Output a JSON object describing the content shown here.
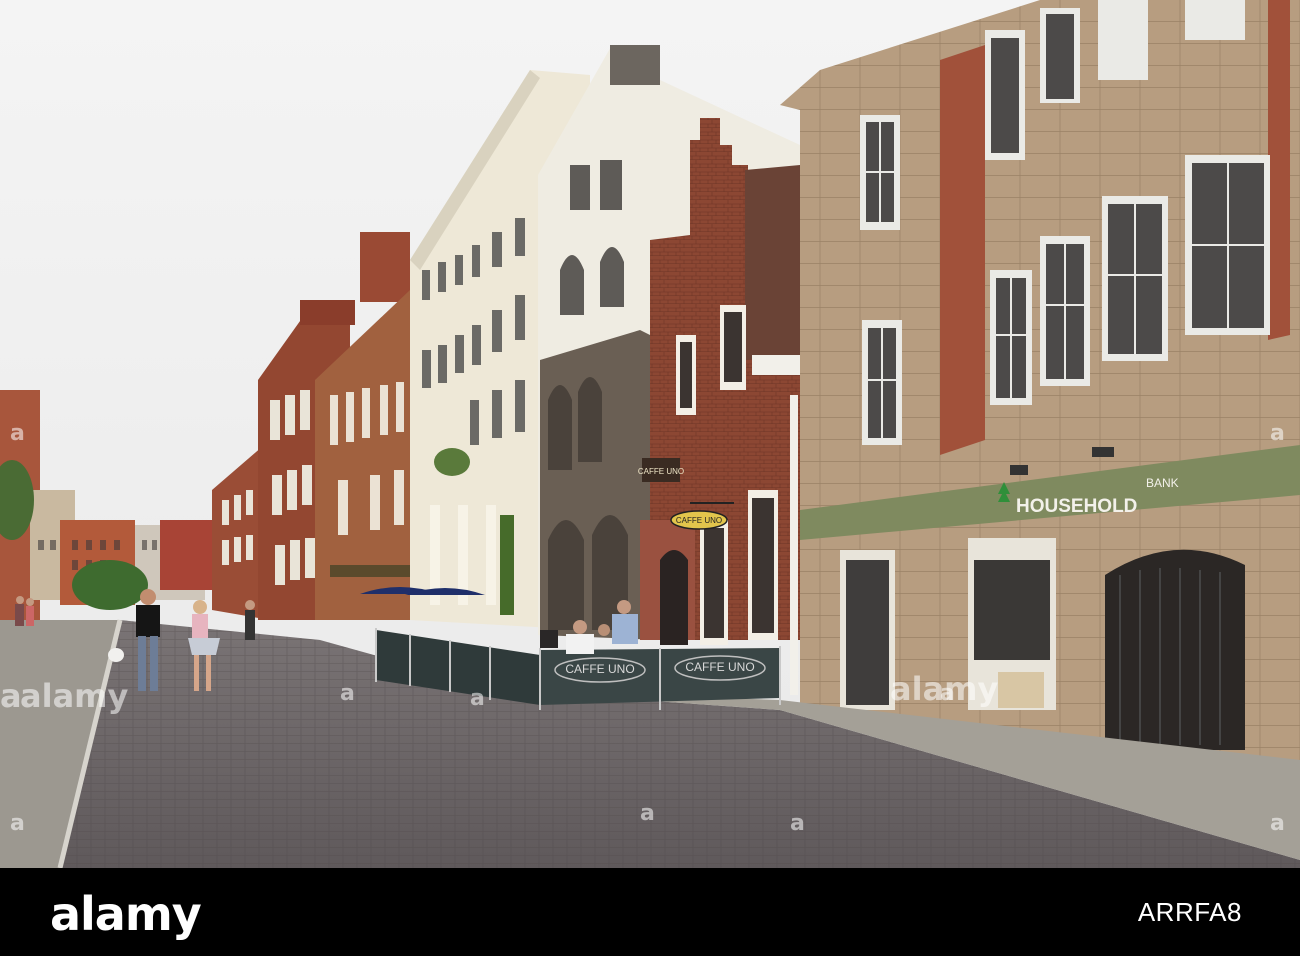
{
  "scene": {
    "signs": {
      "bank_name": "HOUSEHOLD",
      "bank_suffix": "BANK",
      "cafe_hanging": "CAFFE UNO",
      "cafe_wall": "CAFFE UNO",
      "cafe_barrier_1": "CAFFE UNO",
      "cafe_barrier_2": "CAFFE UNO"
    },
    "watermarks": [
      "a",
      "alamy",
      "a",
      "a",
      "a",
      "a",
      "a",
      "a",
      "a",
      "a",
      "a",
      "alamy"
    ]
  },
  "footer": {
    "logo": "alamy",
    "stock_id": "ARRFA8"
  },
  "colors": {
    "sky": "#f2f2f2",
    "cobbles": "#6f6869",
    "pavement": "#9a958d",
    "brick": "#8e4a35",
    "cream": "#efeadb",
    "sandstone": "#b59a7c",
    "footer": "#000000"
  }
}
